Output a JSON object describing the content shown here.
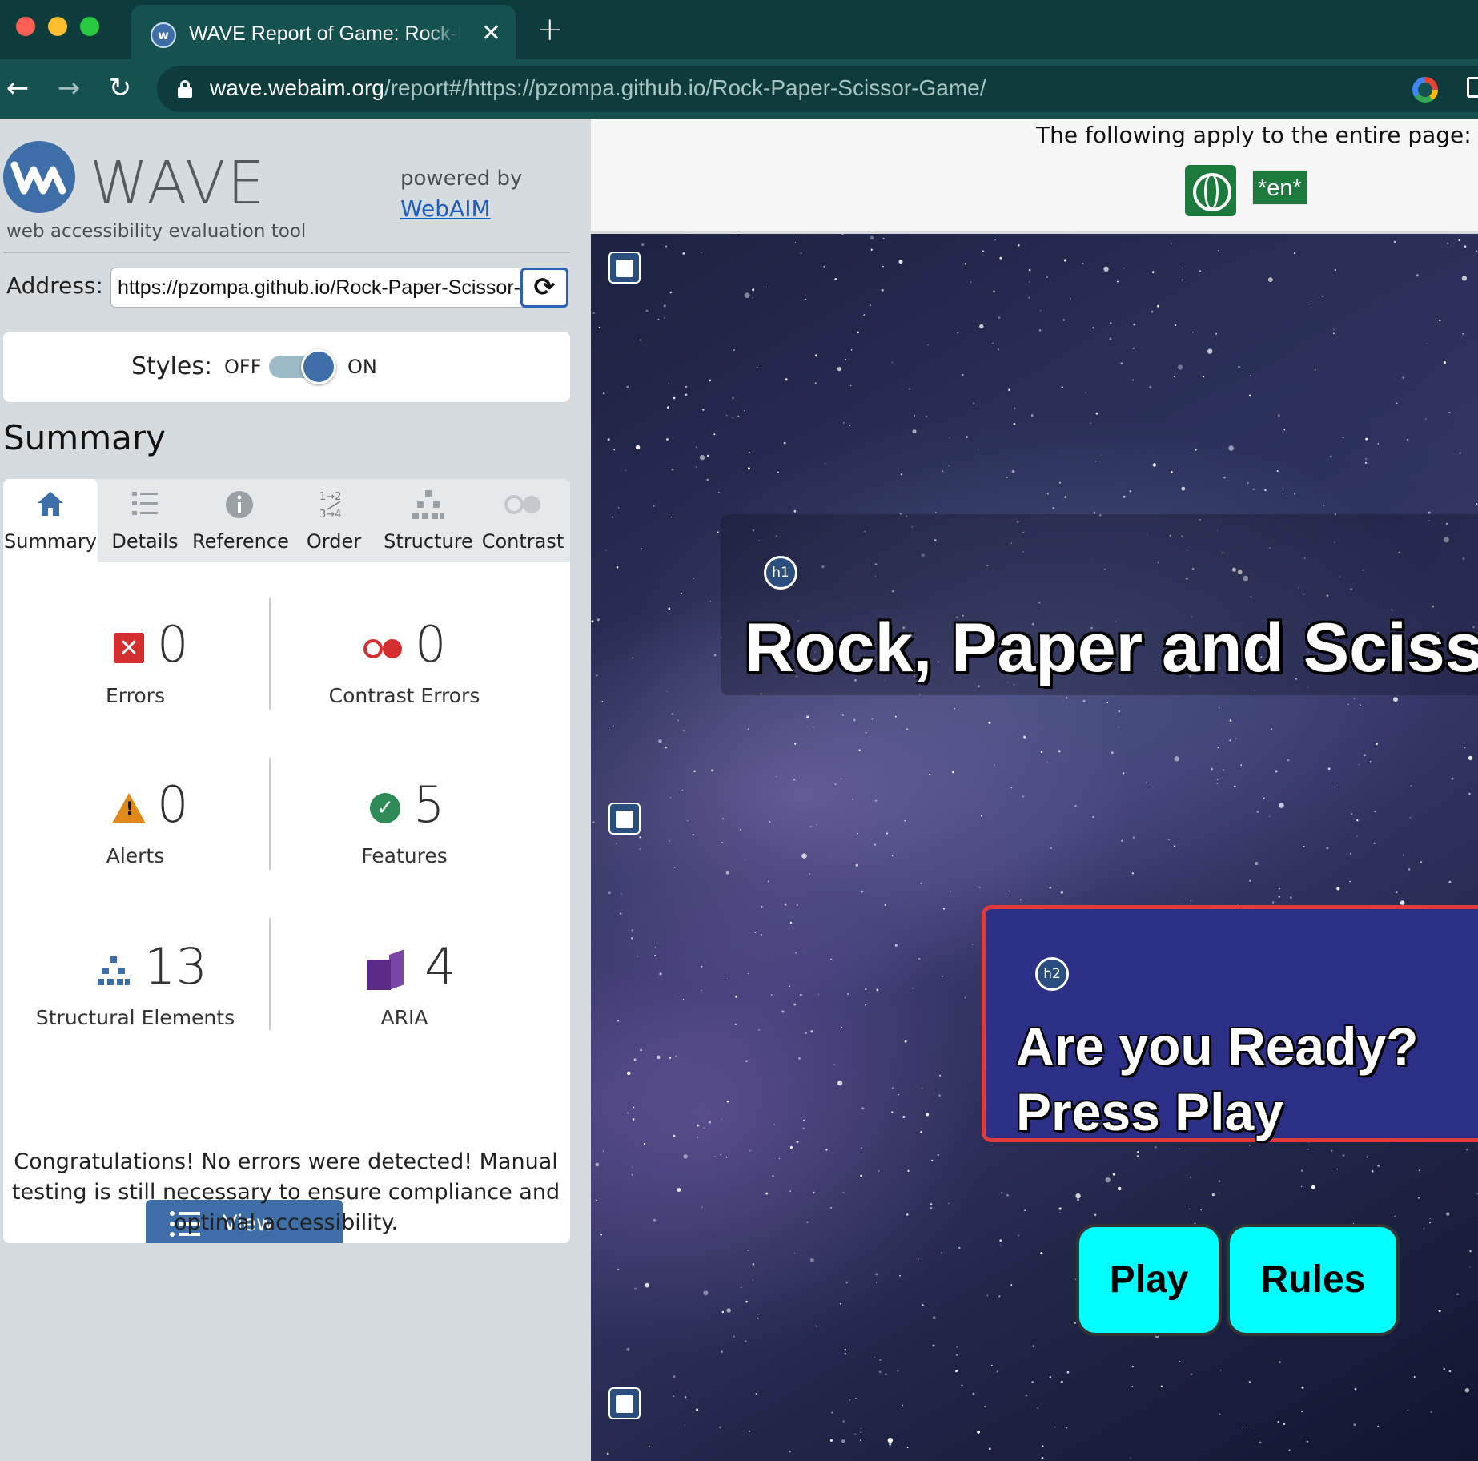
{
  "browser": {
    "tab_title": "WAVE Report of Game: Rock-Paper-Scissor",
    "tab_close": "✕",
    "new_tab": "+",
    "url_host": "wave.webaim.org",
    "url_path": "/report#/https://pzompa.github.io/Rock-Paper-Scissor-Game/",
    "icons": [
      "back-arrow-icon",
      "forward-arrow-icon",
      "reload-icon",
      "lock-icon",
      "google-icon",
      "share-icon"
    ]
  },
  "wave": {
    "logo_text": "WAVE",
    "tagline": "web accessibility evaluation tool",
    "powered_by": "powered by",
    "webaim_link": "WebAIM",
    "address_label": "Address:",
    "address_value": "https://pzompa.github.io/Rock-Paper-Scissor-Game/",
    "styles_label": "Styles:",
    "styles_off": "OFF",
    "styles_on": "ON",
    "styles_state": "on",
    "summary_heading": "Summary",
    "tabs": [
      {
        "label": "Summary",
        "icon": "home-icon",
        "active": true
      },
      {
        "label": "Details",
        "icon": "list-icon",
        "active": false
      },
      {
        "label": "Reference",
        "icon": "info-icon",
        "active": false
      },
      {
        "label": "Order",
        "icon": "order-icon",
        "active": false
      },
      {
        "label": "Structure",
        "icon": "structure-icon",
        "active": false
      },
      {
        "label": "Contrast",
        "icon": "contrast-icon",
        "active": false
      }
    ],
    "stats": {
      "errors": {
        "value": "0",
        "label": "Errors"
      },
      "contrast_errors": {
        "value": "0",
        "label": "Contrast Errors"
      },
      "alerts": {
        "value": "0",
        "label": "Alerts"
      },
      "features": {
        "value": "5",
        "label": "Features"
      },
      "structural": {
        "value": "13",
        "label": "Structural Elements"
      },
      "aria": {
        "value": "4",
        "label": "ARIA"
      }
    },
    "view_details": "View details ›",
    "congrats": "Congratulations! No errors were detected! Manual testing is still necessary to ensure compliance and optimal accessibility."
  },
  "page": {
    "notice": "The following apply to the entire page:",
    "lang_badge": "*en*",
    "h1_badge": "h1",
    "h1_text": "Rock, Paper and Scissors",
    "h2_badge": "h2",
    "h2_line1": "Are you Ready?",
    "h2_line2": "Press Play",
    "play_button": "Play",
    "rules_button": "Rules"
  },
  "colors": {
    "browser_dark": "#0e3c3c",
    "browser_tab": "#14514f",
    "wave_blue": "#3d6ea8",
    "error_red": "#d32f2f",
    "alert_orange": "#e0891a",
    "feature_green": "#2e8b57",
    "aria_purple": "#5b2a86",
    "game_button": "#00ffff",
    "h2_border": "#e03a3a"
  }
}
